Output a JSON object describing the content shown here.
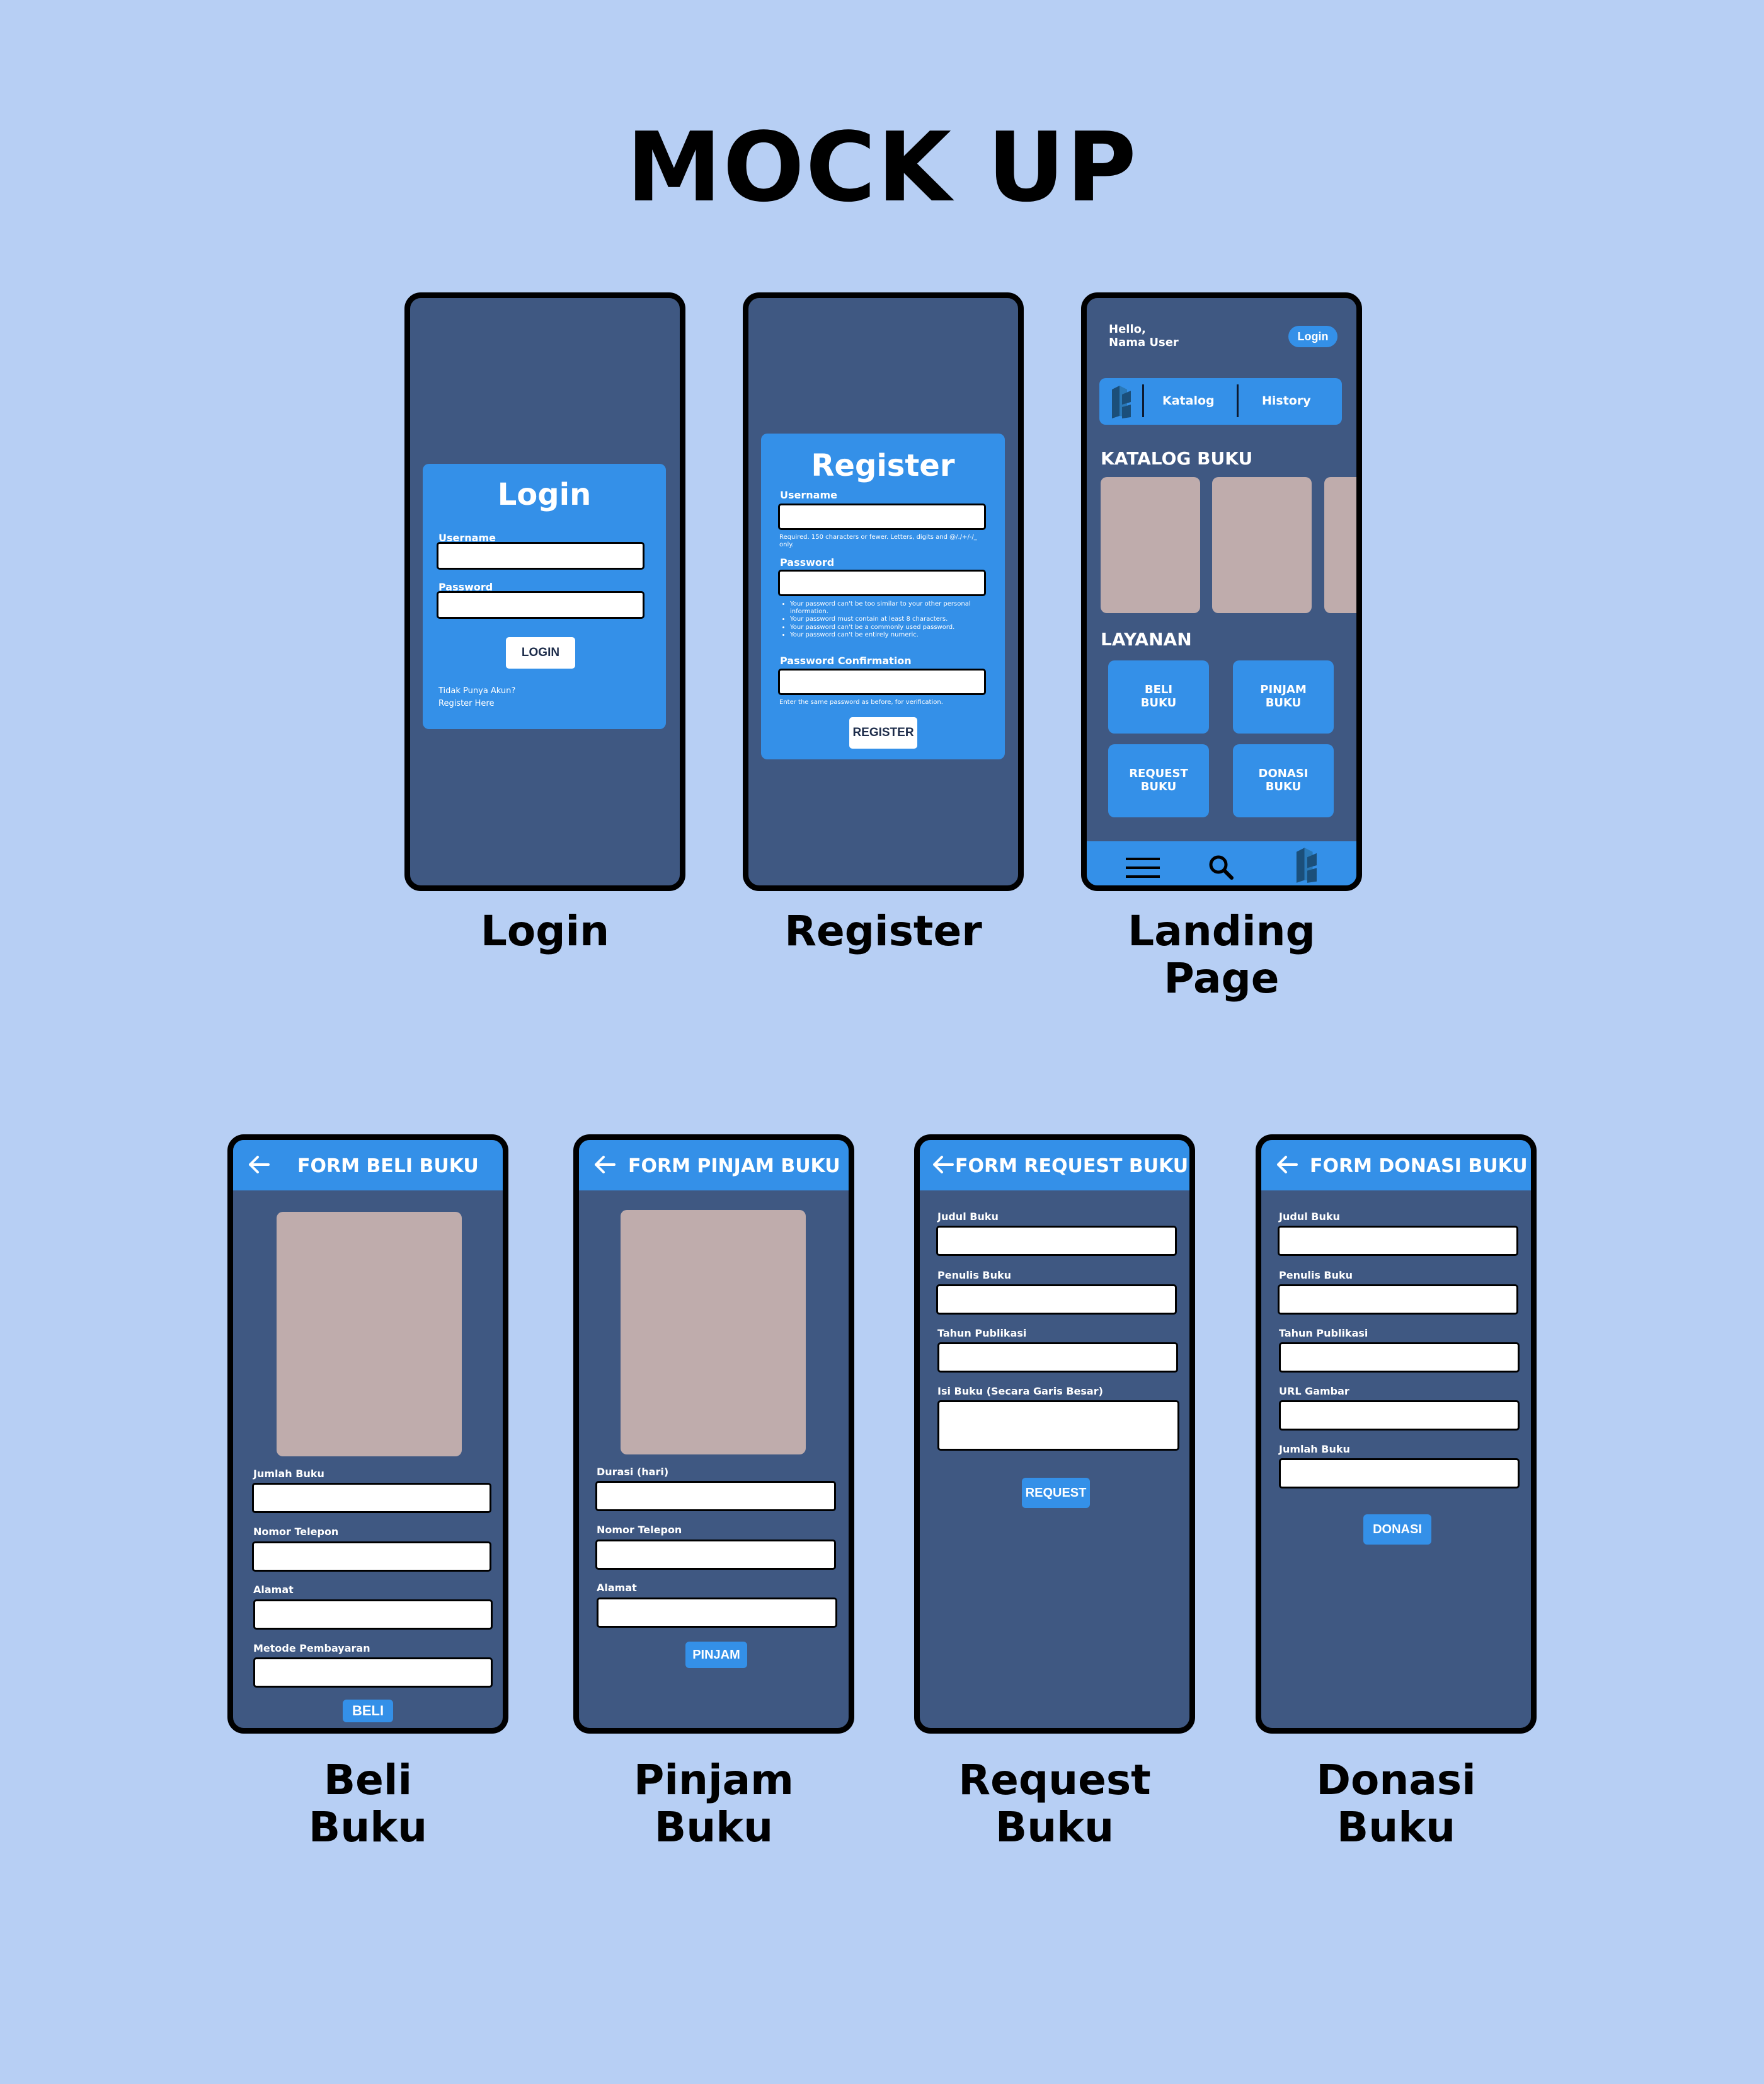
{
  "page_title": "MOCK UP",
  "captions": {
    "login": "Login",
    "register": "Register",
    "landing": "Landing\nPage",
    "beli": "Beli\nBuku",
    "pinjam": "Pinjam\nBuku",
    "request": "Request\nBuku",
    "donasi": "Donasi\nBuku"
  },
  "login_screen": {
    "title": "Login",
    "username_label": "Username",
    "password_label": "Password",
    "button": "LOGIN",
    "no_account": "Tidak Punya Akun?",
    "register_link": "Register Here"
  },
  "register_screen": {
    "title": "Register",
    "username_label": "Username",
    "username_hint": "Required. 150 characters or fewer. Letters, digits and @/./+/-/_ only.",
    "password_label": "Password",
    "password_hints": [
      "Your password can't be too similar to your other personal information.",
      "Your password must contain at least 8 characters.",
      "Your password can't be a commonly used password.",
      "Your password can't be entirely numeric."
    ],
    "confirm_label": "Password Confirmation",
    "confirm_hint": "Enter the same password as before, for verification.",
    "button": "REGISTER"
  },
  "landing_screen": {
    "greeting": "Hello,\nNama User",
    "login_button": "Login",
    "nav": {
      "katalog": "Katalog",
      "history": "History"
    },
    "katalog_heading": "KATALOG BUKU",
    "layanan_heading": "LAYANAN",
    "services": [
      "BELI\nBUKU",
      "PINJAM\nBUKU",
      "REQUEST\nBUKU",
      "DONASI\nBUKU"
    ],
    "icons": {
      "menu": "menu-icon",
      "search": "search-icon",
      "logo": "logo-icon"
    }
  },
  "beli_screen": {
    "header": "FORM BELI BUKU",
    "fields": [
      "Jumlah Buku",
      "Nomor Telepon",
      "Alamat",
      "Metode Pembayaran"
    ],
    "button": "BELI"
  },
  "pinjam_screen": {
    "header": "FORM PINJAM BUKU",
    "fields": [
      "Durasi (hari)",
      "Nomor Telepon",
      "Alamat"
    ],
    "button": "PINJAM"
  },
  "request_screen": {
    "header": "FORM REQUEST BUKU",
    "fields": [
      "Judul Buku",
      "Penulis Buku",
      "Tahun Publikasi",
      "Isi Buku (Secara Garis Besar)"
    ],
    "button": "REQUEST"
  },
  "donasi_screen": {
    "header": "FORM DONASI BUKU",
    "fields": [
      "Judul Buku",
      "Penulis Buku",
      "Tahun Publikasi",
      "URL Gambar",
      "Jumlah Buku"
    ],
    "button": "DONASI"
  },
  "colors": {
    "background": "#b7cff4",
    "phone_body": "#3f5882",
    "accent_blue": "#3490e8",
    "placeholder": "#bfacac"
  }
}
